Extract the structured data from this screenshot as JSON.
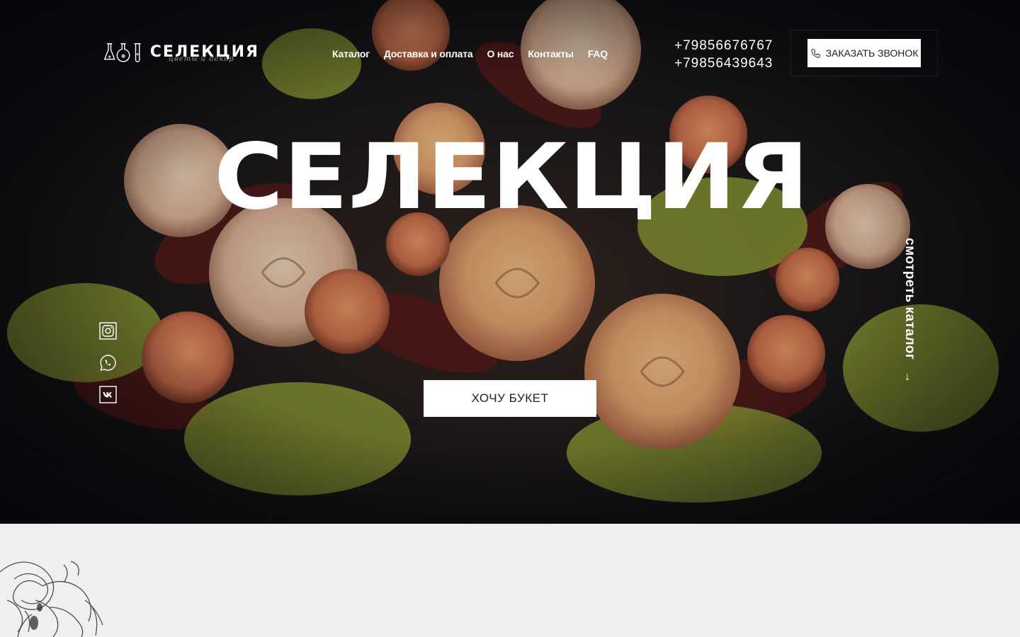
{
  "brand": {
    "name": "СЕЛЕКЦИЯ",
    "tagline": "цветы и декор"
  },
  "nav": {
    "items": [
      "Каталог",
      "Доставка и оплата",
      "О нас",
      "Контакты",
      "FAQ"
    ]
  },
  "contacts": {
    "phones": [
      "+79856676767",
      "+79856439643"
    ],
    "call_button": "ЗАКАЗАТЬ ЗВОНОК"
  },
  "hero": {
    "title": "СЕЛЕКЦИЯ",
    "cta": "ХОЧУ БУКЕТ",
    "catalog_link": "смотреть каталог",
    "catalog_arrow": "↓"
  },
  "socials": {
    "items": [
      "instagram-icon",
      "whatsapp-icon",
      "vk-icon"
    ]
  },
  "colors": {
    "hero_dark": "#111318",
    "rose_peach": "#f0b27a",
    "foliage": "#a8b43a",
    "button_bg": "#ffffff",
    "page_bg": "#efefef"
  }
}
